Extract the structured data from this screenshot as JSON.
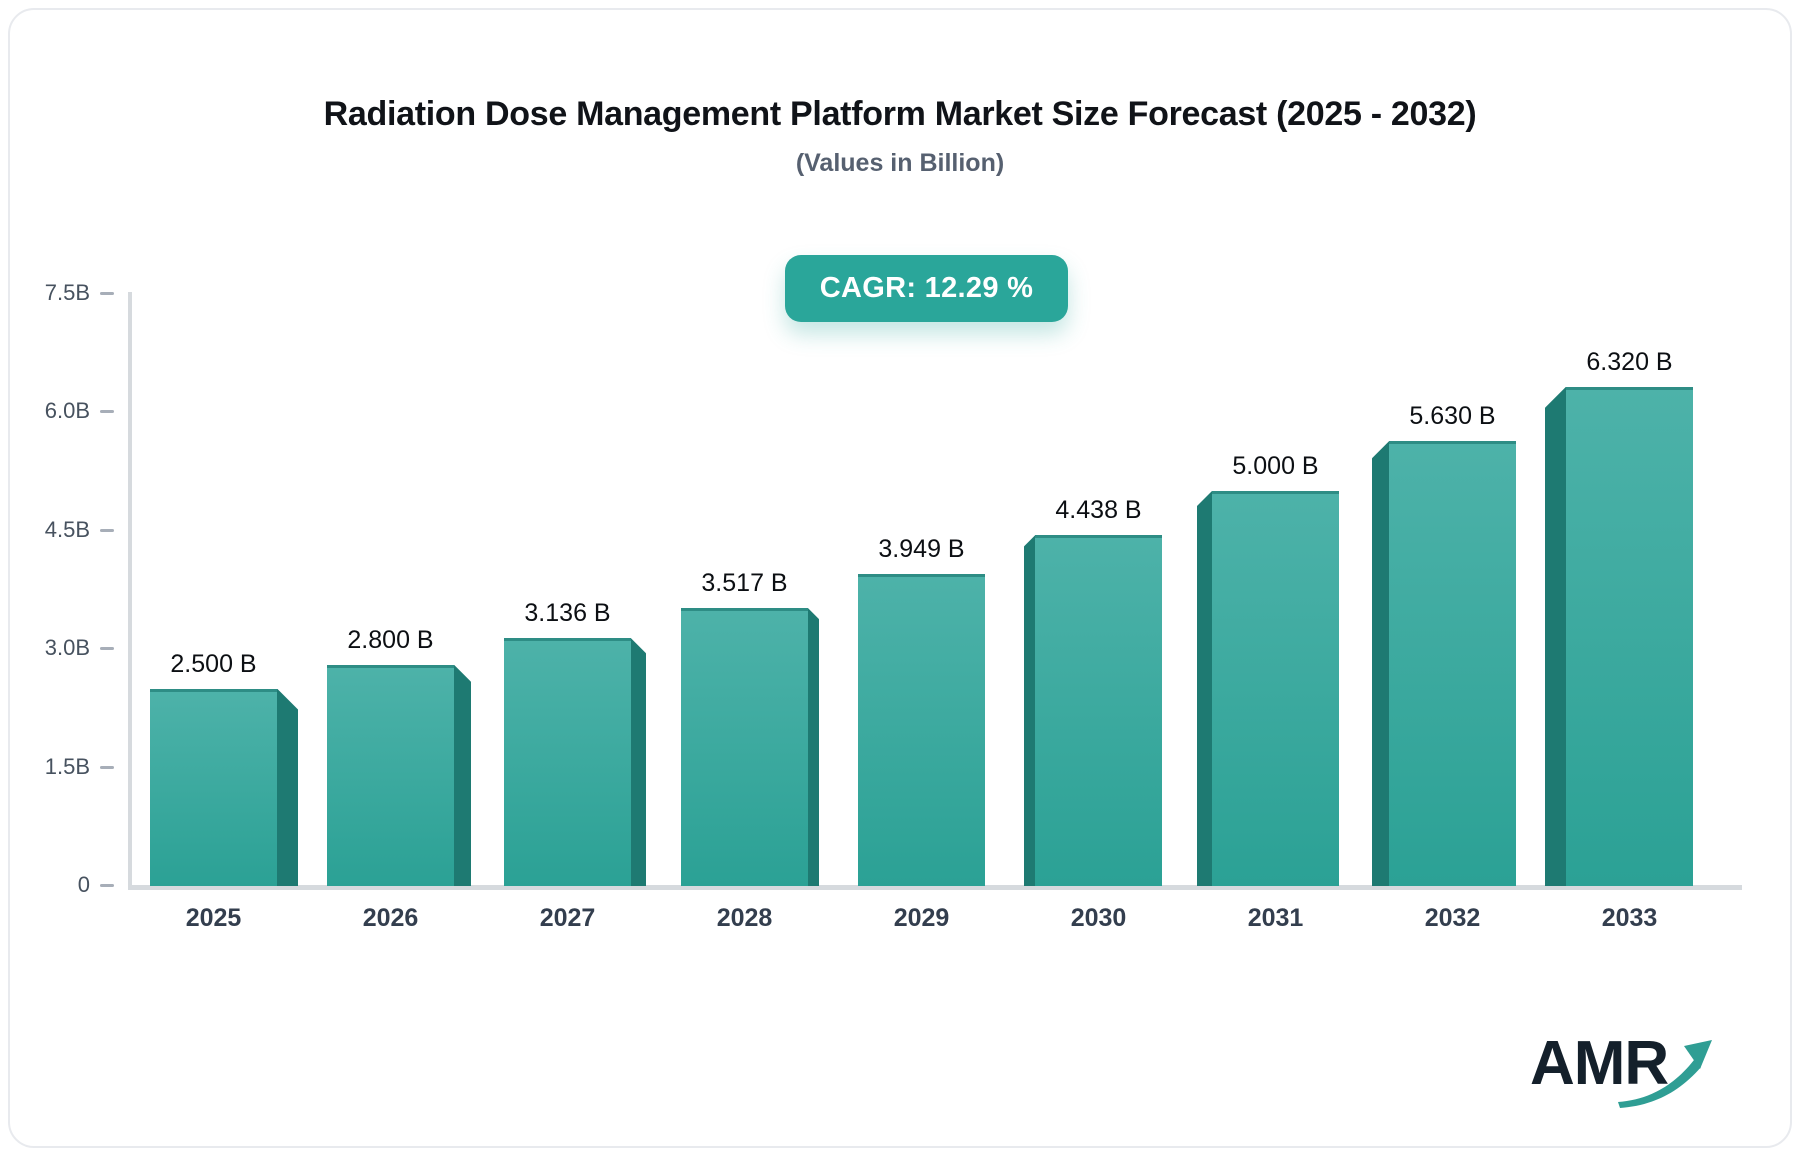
{
  "title": "Radiation Dose Management Platform Market Size Forecast (2025 - 2032)",
  "subtitle": "(Values in Billion)",
  "cagr_badge": "CAGR: 12.29 %",
  "logo": {
    "text": "AMR"
  },
  "chart_data": {
    "type": "bar",
    "title": "Radiation Dose Management Platform Market Size Forecast (2025 - 2032)",
    "subtitle": "(Values in Billion)",
    "annotation": "CAGR: 12.29 %",
    "categories": [
      "2025",
      "2026",
      "2027",
      "2028",
      "2029",
      "2030",
      "2031",
      "2032",
      "2033"
    ],
    "values": [
      2.5,
      2.8,
      3.136,
      3.517,
      3.949,
      4.438,
      5.0,
      5.63,
      6.32
    ],
    "value_labels": [
      "2.500 B",
      "2.800 B",
      "3.136 B",
      "3.517 B",
      "3.949 B",
      "4.438 B",
      "5.000 B",
      "5.630 B",
      "6.320 B"
    ],
    "xlabel": "",
    "ylabel": "",
    "ylim": [
      0,
      7.5
    ],
    "y_ticks": [
      {
        "value": 0.0,
        "label": "0"
      },
      {
        "value": 1.5,
        "label": "1.5B"
      },
      {
        "value": 3.0,
        "label": "3.0B"
      },
      {
        "value": 4.5,
        "label": "4.5B"
      },
      {
        "value": 6.0,
        "label": "6.0B"
      },
      {
        "value": 7.5,
        "label": "7.5B"
      }
    ],
    "grid": "off",
    "legend": "none",
    "style": "3d-perspective-bars",
    "colors": {
      "bar_front_top": "#4db2a9",
      "bar_front_bottom": "#2ba195",
      "bar_side": "#1e7a72",
      "bar_top_edge": "#2e8d85",
      "badge_bg": "#2aa69a",
      "axis_line": "#d6dade",
      "tick_dash": "#a7aeb8",
      "logo_arrow": "#2f9e94"
    }
  }
}
